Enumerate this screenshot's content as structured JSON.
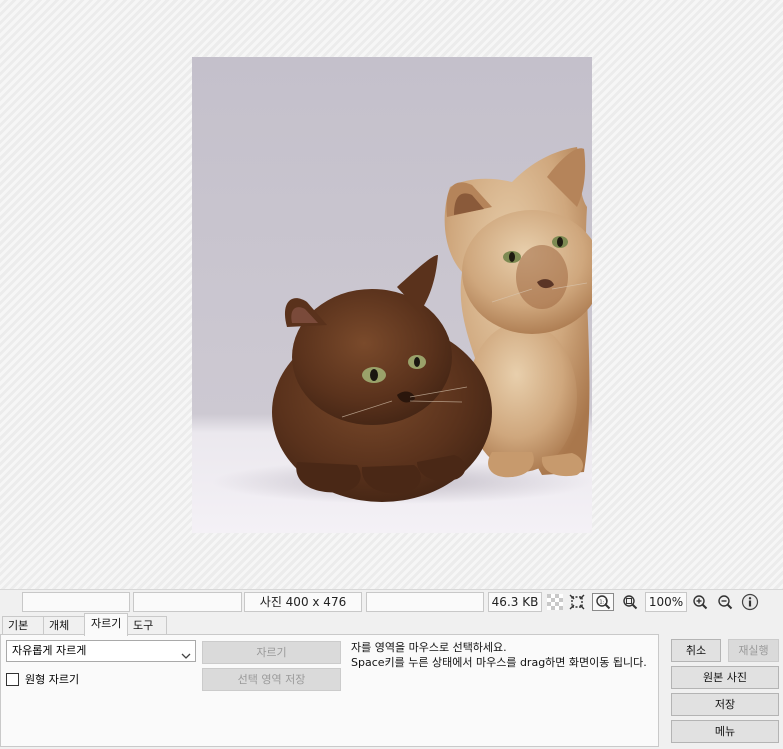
{
  "status": {
    "cell1": "",
    "cell2": "",
    "dimensions": "사진 400 x 476",
    "cell4": "",
    "filesize": "46.3 KB",
    "zoom": "100%",
    "icons": [
      "transparency-icon",
      "fit-window-icon",
      "actual-size-icon",
      "zoom-fit-icon",
      "zoom-in-icon",
      "zoom-out-icon",
      "info-icon"
    ]
  },
  "tabs": [
    {
      "label": "기본",
      "active": false
    },
    {
      "label": "개체",
      "active": false
    },
    {
      "label": "자르기",
      "active": true
    },
    {
      "label": "도구",
      "active": false
    }
  ],
  "crop": {
    "mode_value": "자유롭게 자르게",
    "circle_label": "원형 자르기",
    "circle_checked": false,
    "crop_button": "자르기",
    "save_selection_button": "선택 영역 저장",
    "hint_line1": "자를 영역을 마우스로 선택하세요.",
    "hint_line2": "Space키를 누른 상태에서 마우스를 drag하면 화면이동 됩니다."
  },
  "actions": {
    "cancel": "취소",
    "redo": "재실행",
    "original": "원본 사진",
    "save": "저장",
    "menu": "메뉴"
  },
  "colors": {
    "canvas_bg": "#ececec",
    "panel_bg": "#fafafa",
    "button_bg": "#e1e1e1"
  }
}
